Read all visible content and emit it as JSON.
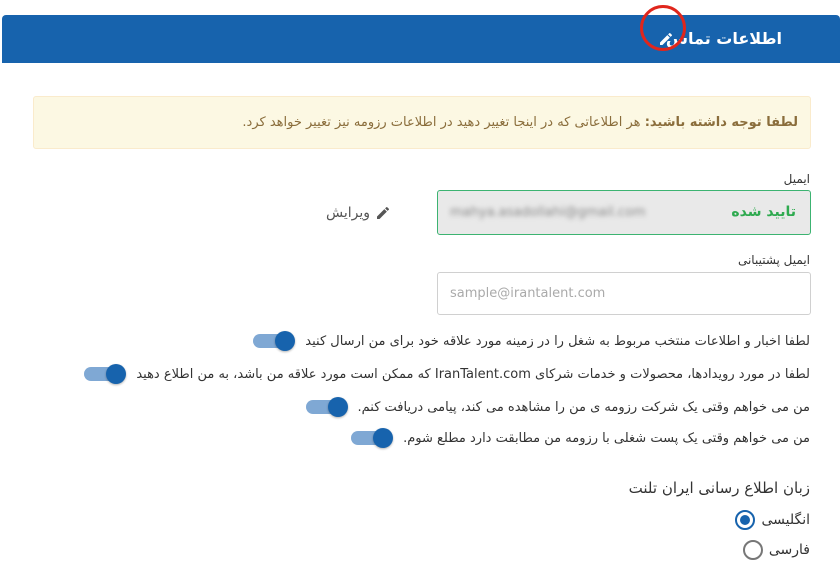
{
  "header": {
    "title": "اطلاعات تماس",
    "edit_icon": "pencil-icon"
  },
  "notice": {
    "bold": "لطفا توجه داشته باشید:",
    "text": " هر اطلاعاتی که در اینجا تغییر دهید در اطلاعات رزومه نیز تغییر خواهد کرد."
  },
  "email": {
    "label": "ایمیل",
    "value": "mahya.asadollahi@gmail.com",
    "status": "تایید شده",
    "edit_label": "ویرایش"
  },
  "backup_email": {
    "label": "ایمیل پشتیبانی",
    "placeholder": "sample@irantalent.com",
    "value": ""
  },
  "toggles": [
    {
      "label": "لطفا اخبار و اطلاعات منتخب مربوط به شغل را در زمینه مورد علاقه خود برای من ارسال کنید",
      "on": true
    },
    {
      "label": "لطفا در مورد رویدادها، محصولات و خدمات شرکای IranTalent.com که ممکن است مورد علاقه من باشد، به من اطلاع دهید",
      "on": true
    },
    {
      "label": "من می خواهم وقتی یک شرکت رزومه ی من را مشاهده می کند، پیامی دریافت کنم.",
      "on": true
    },
    {
      "label": "من می خواهم وقتی یک پست شغلی با رزومه من مطابقت دارد مطلع شوم.",
      "on": true
    }
  ],
  "language": {
    "title": "زبان اطلاع رسانی ایران تلنت",
    "options": [
      {
        "label": "انگلیسی",
        "selected": true
      },
      {
        "label": "فارسی",
        "selected": false
      }
    ]
  },
  "colors": {
    "header_bg": "#1763ad",
    "verified": "#2eaa4f",
    "highlight": "#e0261c"
  }
}
